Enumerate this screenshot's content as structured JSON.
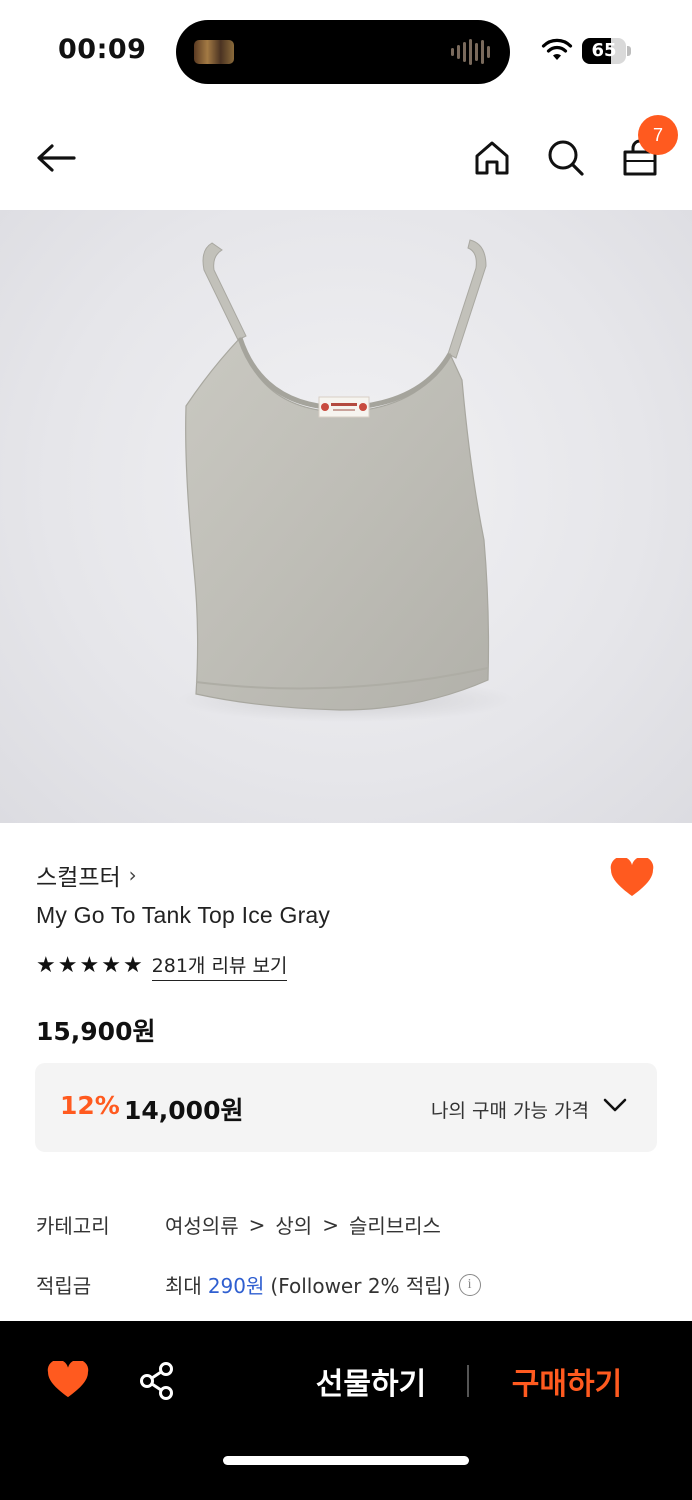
{
  "status": {
    "time": "00:09",
    "battery": "65",
    "battery_level": 0.65
  },
  "nav": {
    "cart_count": "7"
  },
  "product": {
    "brand": "스컬프터",
    "title": "My Go To Tank Top Ice Gray",
    "rating_stars": 5,
    "review_link": "281개 리뷰 보기",
    "original_price": "15,900원",
    "discount_rate": "12%",
    "sale_price": "14,000원",
    "my_price_label": "나의 구매 가능 가격",
    "category_label": "카테고리",
    "categories": [
      "여성의류",
      "상의",
      "슬리브리스"
    ],
    "points_label": "적립금",
    "points_prefix": "최대",
    "points_amount": "290원",
    "points_suffix": "(Follower 2% 적립)",
    "wishlisted": true
  },
  "bottom_bar": {
    "gift_label": "선물하기",
    "buy_label": "구매하기"
  },
  "colors": {
    "accent": "#ff5a1f",
    "link_blue": "#2f5fd0",
    "bottom_bar_bg": "#000000"
  },
  "icons": {
    "back": "arrow-left-icon",
    "home": "home-icon",
    "search": "search-icon",
    "cart": "shopping-bag-icon",
    "wish": "heart-icon",
    "share": "share-icon",
    "info": "info-icon"
  }
}
